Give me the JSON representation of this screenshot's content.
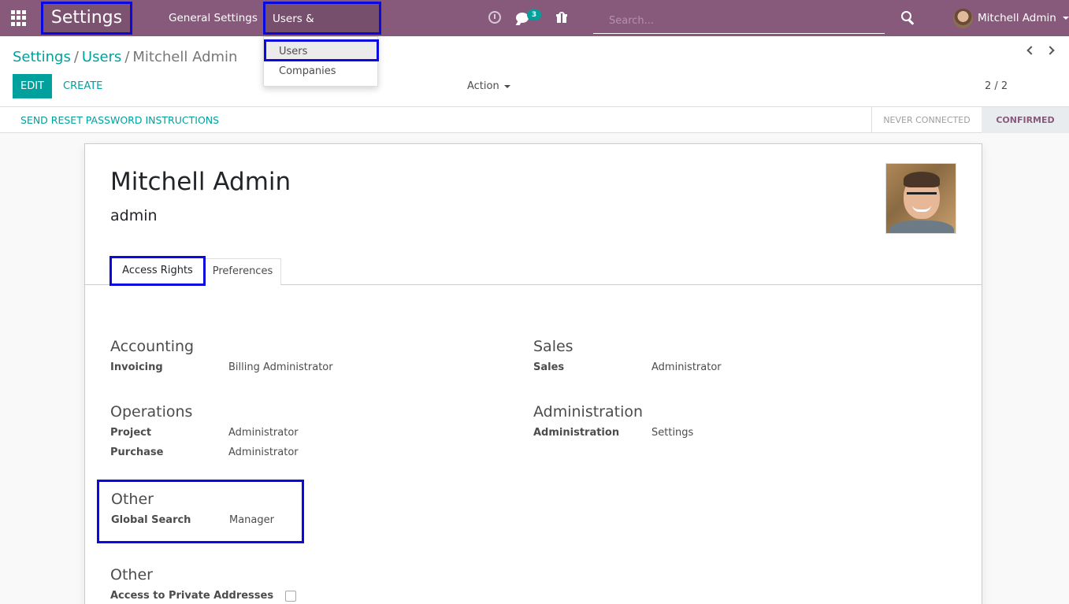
{
  "navbar": {
    "brand": "Settings",
    "menu": {
      "general": "General Settings",
      "users_companies": "Users & Companies"
    },
    "chat_badge": "3",
    "search_placeholder": "Search...",
    "user_name": "Mitchell Admin"
  },
  "dropdown": {
    "items": [
      "Users",
      "Companies"
    ]
  },
  "breadcrumb": {
    "items": [
      "Settings",
      "Users"
    ],
    "current": "Mitchell Admin",
    "separator": "/"
  },
  "toolbar": {
    "edit_label": "EDIT",
    "create_label": "CREATE",
    "action_label": "Action",
    "pager": "2 / 2"
  },
  "status": {
    "reset_label": "SEND RESET PASSWORD INSTRUCTIONS",
    "stages": [
      "NEVER CONNECTED",
      "CONFIRMED"
    ],
    "active_stage": "CONFIRMED"
  },
  "form": {
    "name": "Mitchell Admin",
    "login": "admin",
    "tabs": [
      "Access Rights",
      "Preferences"
    ],
    "active_tab": "Access Rights",
    "groups": {
      "accounting": {
        "title": "Accounting",
        "fields": [
          {
            "label": "Invoicing",
            "value": "Billing Administrator"
          }
        ]
      },
      "sales": {
        "title": "Sales",
        "fields": [
          {
            "label": "Sales",
            "value": "Administrator"
          }
        ]
      },
      "operations": {
        "title": "Operations",
        "fields": [
          {
            "label": "Project",
            "value": "Administrator"
          },
          {
            "label": "Purchase",
            "value": "Administrator"
          }
        ]
      },
      "administration": {
        "title": "Administration",
        "fields": [
          {
            "label": "Administration",
            "value": "Settings"
          }
        ]
      },
      "other1": {
        "title": "Other",
        "fields": [
          {
            "label": "Global Search",
            "value": "Manager"
          }
        ]
      },
      "other2": {
        "title": "Other",
        "fields": [
          {
            "label": "Access to Private Addresses",
            "checked": false
          }
        ]
      }
    }
  },
  "colors": {
    "navbar": "#875a7b",
    "primary": "#00a09d",
    "highlight": "#0a0ae0"
  }
}
